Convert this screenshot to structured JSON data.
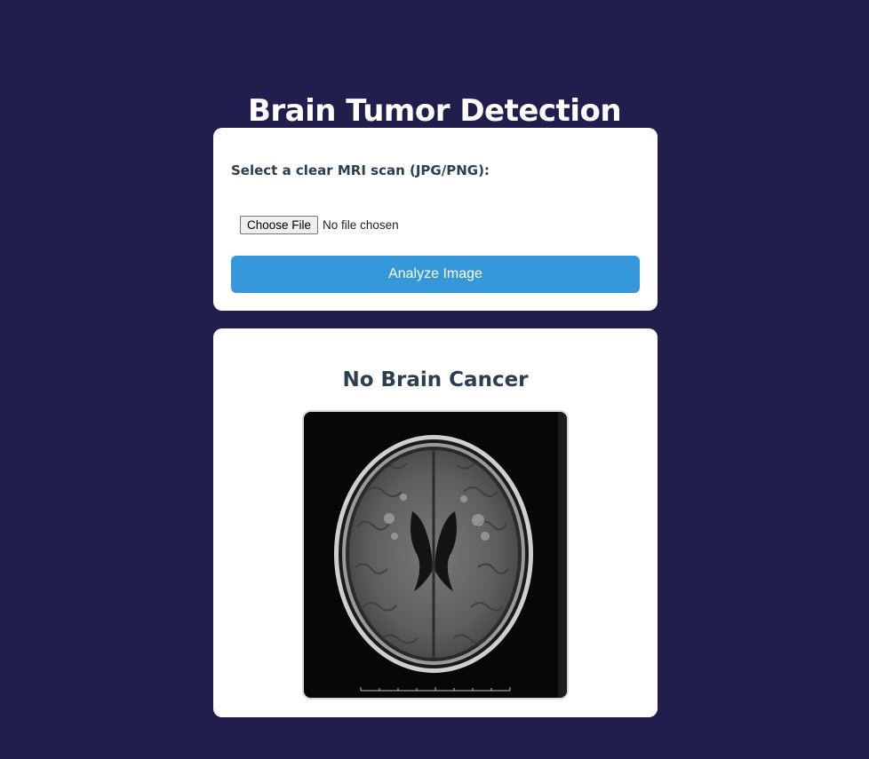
{
  "page": {
    "title": "Brain Tumor Detection"
  },
  "upload": {
    "label": "Select a clear MRI scan (JPG/PNG):",
    "choose_button": "Choose File",
    "file_status": "No file chosen",
    "analyze_button": "Analyze Image"
  },
  "result": {
    "heading": "No Brain Cancer",
    "image_alt": "brain MRI scan"
  },
  "colors": {
    "background": "#211e4d",
    "card": "#ffffff",
    "accent_button": "#3498db",
    "heading_text": "#2c3e50"
  }
}
